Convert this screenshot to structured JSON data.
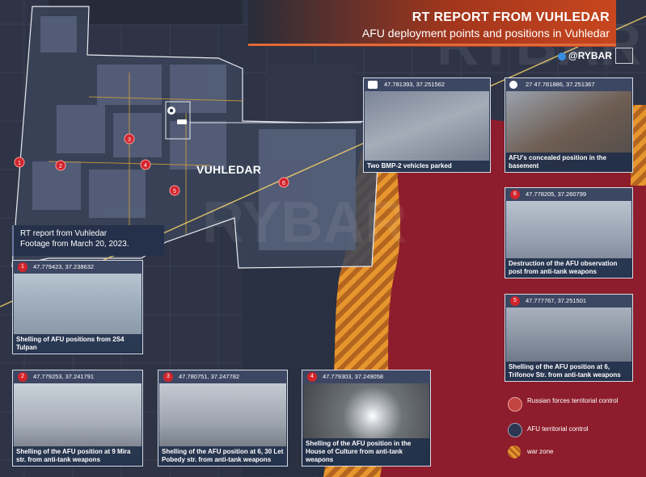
{
  "header": {
    "title": "RT REPORT FROM VUHLEDAR",
    "subtitle": "AFU deployment points and positions in Vuhledar",
    "brand": "@RYBAR"
  },
  "map": {
    "place_label": "VUHLEDAR",
    "watermark": "RYBAR",
    "note_line1": "RT report from Vuhledar",
    "note_line2": "Footage from March 20, 2023.",
    "markers": [
      "1",
      "2",
      "3",
      "4",
      "5",
      "6"
    ],
    "colors": {
      "russian": "#8d1d2c",
      "afu": "#2c3650",
      "warzone": "#e08a2a",
      "marker": "#d2242b"
    }
  },
  "cards": [
    {
      "num": "",
      "coords": "47.781393, 37.251562",
      "caption": "Two BMP-2 vehicles parked",
      "icon": "vehicle-icon"
    },
    {
      "num": "",
      "coords": "27 47.781886, 37.251367",
      "caption": "AFU's concealed position in the basement",
      "icon": "position-icon"
    },
    {
      "num": "6",
      "coords": "47.778205, 37.260799",
      "caption": "Destruction of the AFU observation post from anti-tank weapons"
    },
    {
      "num": "5",
      "coords": "47.777767, 37.251501",
      "caption": "Shelling of the AFU position at 6, Trifonov Str. from anti-tank weapons"
    },
    {
      "num": "1",
      "coords": "47.779423, 37.238632",
      "caption": "Shelling of AFU positions from 2S4 Tulpan"
    },
    {
      "num": "2",
      "coords": "47.779253, 37.241791",
      "caption": "Shelling of the AFU position at 9 Mira str. from anti-tank weapons"
    },
    {
      "num": "3",
      "coords": "47.780751, 37.247782",
      "caption": "Shelling of the AFU position at 6, 30 Let Pobedy str. from anti-tank weapons"
    },
    {
      "num": "4",
      "coords": "47.779303, 37.249058",
      "caption": "Shelling of the AFU position in the House of Culture from anti-tank weapons"
    }
  ],
  "legend": [
    {
      "label": "Russian forces territorial control"
    },
    {
      "label": "AFU territorial control"
    },
    {
      "label": "war zone"
    }
  ]
}
